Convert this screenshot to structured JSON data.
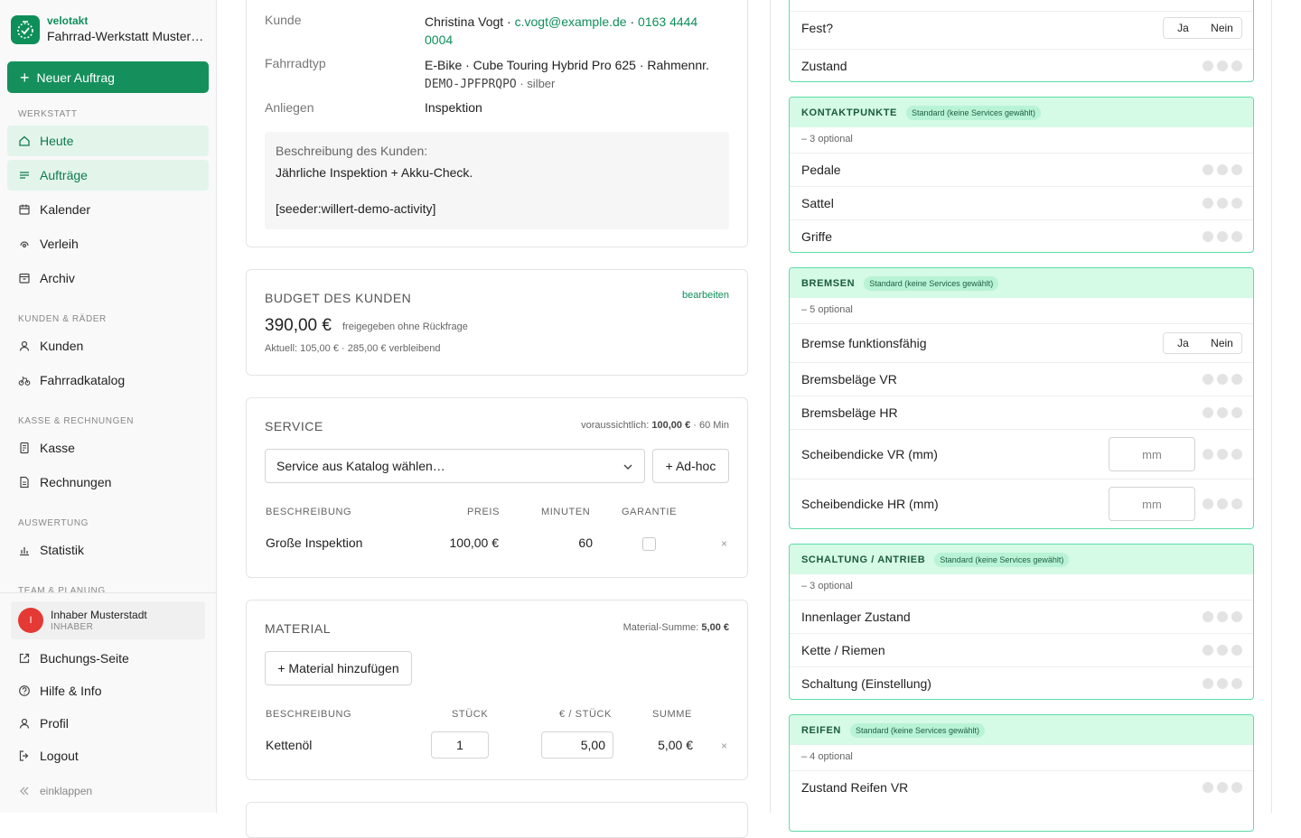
{
  "brand": {
    "app": "velotakt",
    "name": "Fahrrad-Werkstatt Musterstadt"
  },
  "sidebar": {
    "new_order": "Neuer Auftrag",
    "sections": [
      "WERKSTATT",
      "KUNDEN & RÄDER",
      "KASSE & RECHNUNGEN",
      "AUSWERTUNG",
      "TEAM & PLANUNG"
    ],
    "items": [
      {
        "label": "Heute",
        "icon": "home-icon"
      },
      {
        "label": "Aufträge",
        "icon": "list-icon"
      },
      {
        "label": "Kalender",
        "icon": "calendar-icon"
      },
      {
        "label": "Verleih",
        "icon": "rental-icon"
      },
      {
        "label": "Archiv",
        "icon": "archive-icon"
      },
      {
        "label": "Kunden",
        "icon": "user-icon"
      },
      {
        "label": "Fahrradkatalog",
        "icon": "bike-icon"
      },
      {
        "label": "Kasse",
        "icon": "register-icon"
      },
      {
        "label": "Rechnungen",
        "icon": "invoice-icon"
      },
      {
        "label": "Statistik",
        "icon": "chart-icon"
      }
    ],
    "user": {
      "initial": "I",
      "name": "Inhaber Musterstadt",
      "role": "INHABER"
    },
    "footer": [
      {
        "label": "Buchungs-Seite",
        "icon": "external-link-icon"
      },
      {
        "label": "Hilfe & Info",
        "icon": "help-icon"
      },
      {
        "label": "Profil",
        "icon": "profile-icon"
      },
      {
        "label": "Logout",
        "icon": "logout-icon"
      }
    ],
    "collapse": "einklappen"
  },
  "order": {
    "customer_label": "Kunde",
    "customer_name": "Christina Vogt",
    "customer_sep": " · ",
    "customer_email": "c.vogt@example.de",
    "customer_phone_a": "0163 4444",
    "customer_phone_b": "0004",
    "bike_label": "Fahrradtyp",
    "bike_line1": "E-Bike · Cube Touring Hybrid Pro 625 · Rahmennr.",
    "bike_frame": "DEMO-JPFPRQPO",
    "bike_color": " · silber",
    "concern_label": "Anliegen",
    "concern_value": "Inspektion",
    "desc_title": "Beschreibung des Kunden:",
    "desc_line1": "Jährliche Inspektion + Akku-Check.",
    "desc_line2": "[seeder:willert-demo-activity]"
  },
  "budget": {
    "title": "BUDGET DES KUNDEN",
    "edit": "bearbeiten",
    "amount": "390,00 €",
    "note": "freigegeben ohne Rückfrage",
    "current": "Aktuell: 105,00 € · 285,00 € verbleibend"
  },
  "service": {
    "title": "SERVICE",
    "estimate_prefix": "voraussichtlich: ",
    "estimate_amount": "100,00 €",
    "estimate_suffix": " · 60 Min",
    "select_placeholder": "Service aus Katalog wählen…",
    "adhoc": "+ Ad-hoc",
    "headers": [
      "BESCHREIBUNG",
      "PREIS",
      "MINUTEN",
      "GARANTIE"
    ],
    "row": {
      "desc": "Große Inspektion",
      "price": "100,00 €",
      "minutes": "60"
    },
    "remove": "×"
  },
  "material": {
    "title": "MATERIAL",
    "sum_prefix": "Material-Summe: ",
    "sum_amount": "5,00 €",
    "add": "+ Material hinzufügen",
    "headers": [
      "BESCHREIBUNG",
      "STÜCK",
      "€ / STÜCK",
      "SUMME"
    ],
    "row": {
      "desc": "Kettenöl",
      "qty": "1",
      "unit": "5,00",
      "sum": "5,00 €"
    },
    "remove": "×"
  },
  "checklist": {
    "yes": "Ja",
    "no": "Nein",
    "mm": "mm",
    "top_rows": [
      "Fest?",
      "Zustand"
    ],
    "groups": [
      {
        "title": "KONTAKTPUNKTE",
        "tag": "Standard (keine Services gewählt)",
        "optional": "– 3 optional",
        "rows": [
          "Pedale",
          "Sattel",
          "Griffe"
        ]
      },
      {
        "title": "BREMSEN",
        "tag": "Standard (keine Services gewählt)",
        "optional": "– 5 optional",
        "rows": [
          "Bremse funktionsfähig",
          "Bremsbeläge VR",
          "Bremsbeläge HR",
          "Scheibendicke VR (mm)",
          "Scheibendicke HR (mm)"
        ]
      },
      {
        "title": "SCHALTUNG / ANTRIEB",
        "tag": "Standard (keine Services gewählt)",
        "optional": "– 3 optional",
        "rows": [
          "Innenlager Zustand",
          "Kette / Riemen",
          "Schaltung (Einstellung)"
        ]
      },
      {
        "title": "REIFEN",
        "tag": "Standard (keine Services gewählt)",
        "optional": "– 4 optional",
        "rows": [
          "Zustand Reifen VR"
        ]
      }
    ]
  }
}
